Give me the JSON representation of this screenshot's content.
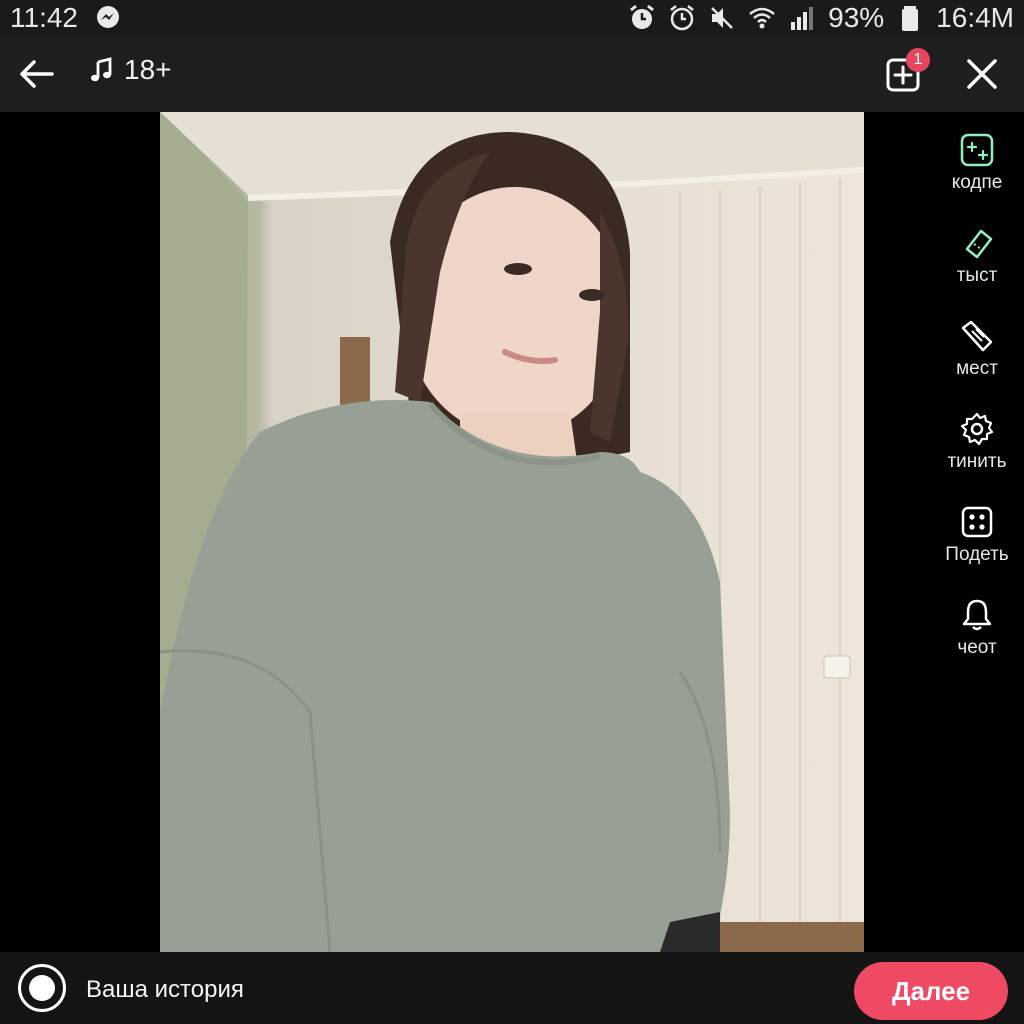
{
  "status_bar": {
    "time": "11:42",
    "battery_percent": "93%",
    "network_speed": "16:4M",
    "icons": [
      "messenger-icon",
      "alarm-clock-icon",
      "alarm-icon",
      "mute-icon",
      "wifi-icon",
      "signal-icon",
      "battery-icon"
    ]
  },
  "top_bar": {
    "music_label": "18+",
    "notification_count": "1"
  },
  "tools": [
    {
      "label": "кодпе",
      "icon": "sparkle-square-icon"
    },
    {
      "label": "тыст",
      "icon": "ticket-icon"
    },
    {
      "label": "мест",
      "icon": "tag-icon"
    },
    {
      "label": "тинить",
      "icon": "gear-icon"
    },
    {
      "label": "Подеть",
      "icon": "dice-icon"
    },
    {
      "label": "чеот",
      "icon": "bell-icon"
    }
  ],
  "bottom_bar": {
    "story_label": "Ваша история",
    "next_button": "Далее"
  },
  "colors": {
    "accent": "#ef4a64",
    "tool_icon": "#8ff0c0"
  }
}
